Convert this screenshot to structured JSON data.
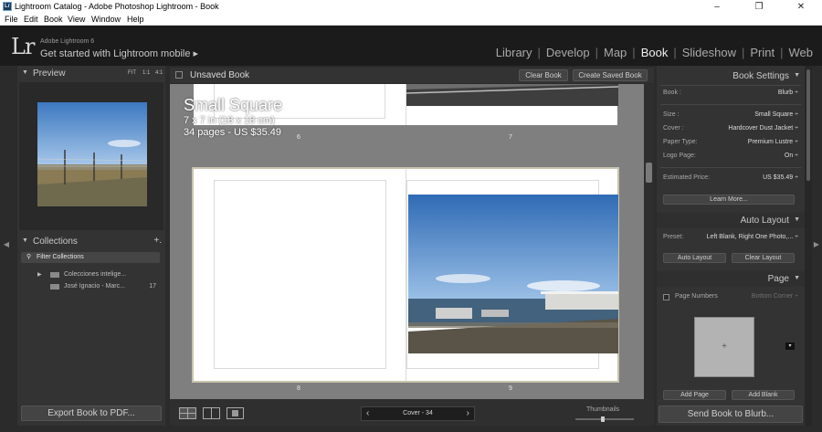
{
  "window": {
    "title": "Lightroom Catalog - Adobe Photoshop Lightroom - Book",
    "app_icon": "Lr",
    "controls": [
      "–",
      "❐",
      "✕"
    ]
  },
  "menubar": [
    "File",
    "Edit",
    "Book",
    "View",
    "Window",
    "Help"
  ],
  "header": {
    "logo": "Lr",
    "version": "Adobe Lightroom 6",
    "mobile": "Get started with Lightroom mobile ▸",
    "modules": [
      "Library",
      "Develop",
      "Map",
      "Book",
      "Slideshow",
      "Print",
      "Web"
    ],
    "active_module": "Book"
  },
  "left_panel": {
    "preview": {
      "title": "Preview",
      "zoom": [
        "FIT",
        "1:1",
        "4:1"
      ]
    },
    "collections": {
      "title": "Collections",
      "add": "+.",
      "filter": "Filter Collections",
      "items": [
        {
          "arrow": "▶",
          "name": "Colecciones intelige...",
          "count": ""
        },
        {
          "arrow": "",
          "name": "José Ignacio - Marc...",
          "count": "17"
        }
      ]
    },
    "export_button": "Export Book to PDF..."
  },
  "center": {
    "title": "Unsaved Book",
    "clear_button": "Clear Book",
    "create_button": "Create Saved Book",
    "book_info": {
      "title": "Small Square",
      "size": "7 x 7 in (18 x 18 cm)",
      "pages": "34 pages - US $35.49"
    },
    "page_numbers": [
      "6",
      "7",
      "8",
      "9"
    ],
    "pager": {
      "prev": "‹",
      "label": "Cover - 34",
      "next": "›"
    },
    "thumbnails_label": "Thumbnails"
  },
  "right_panel": {
    "book_settings": {
      "title": "Book Settings",
      "book_label": "Book :",
      "book_value": "Blurb ÷",
      "rows": [
        {
          "label": "Size :",
          "value": "Small Square ÷"
        },
        {
          "label": "Cover :",
          "value": "Hardcover Dust Jacket ÷"
        },
        {
          "label": "Paper Type:",
          "value": "Premium Lustre ÷"
        },
        {
          "label": "Logo Page:",
          "value": "On ÷"
        }
      ],
      "price_label": "Estimated Price:",
      "price_value": "US $35.49 ÷",
      "learn_more": "Learn More..."
    },
    "auto_layout": {
      "title": "Auto Layout",
      "preset_label": "Preset:",
      "preset_value": "Left Blank, Right One Photo,... ÷",
      "auto_button": "Auto Layout",
      "clear_button": "Clear Layout"
    },
    "page": {
      "title": "Page",
      "page_numbers_label": "Page Numbers",
      "position_value": "Bottom Corner ÷",
      "add_page": "Add Page",
      "add_blank": "Add Blank",
      "plus": "+"
    },
    "send_button": "Send Book to Blurb..."
  },
  "colors": {
    "accent": "#f0f0f0",
    "panel": "#333333",
    "canvas": "#7f7f7f"
  }
}
